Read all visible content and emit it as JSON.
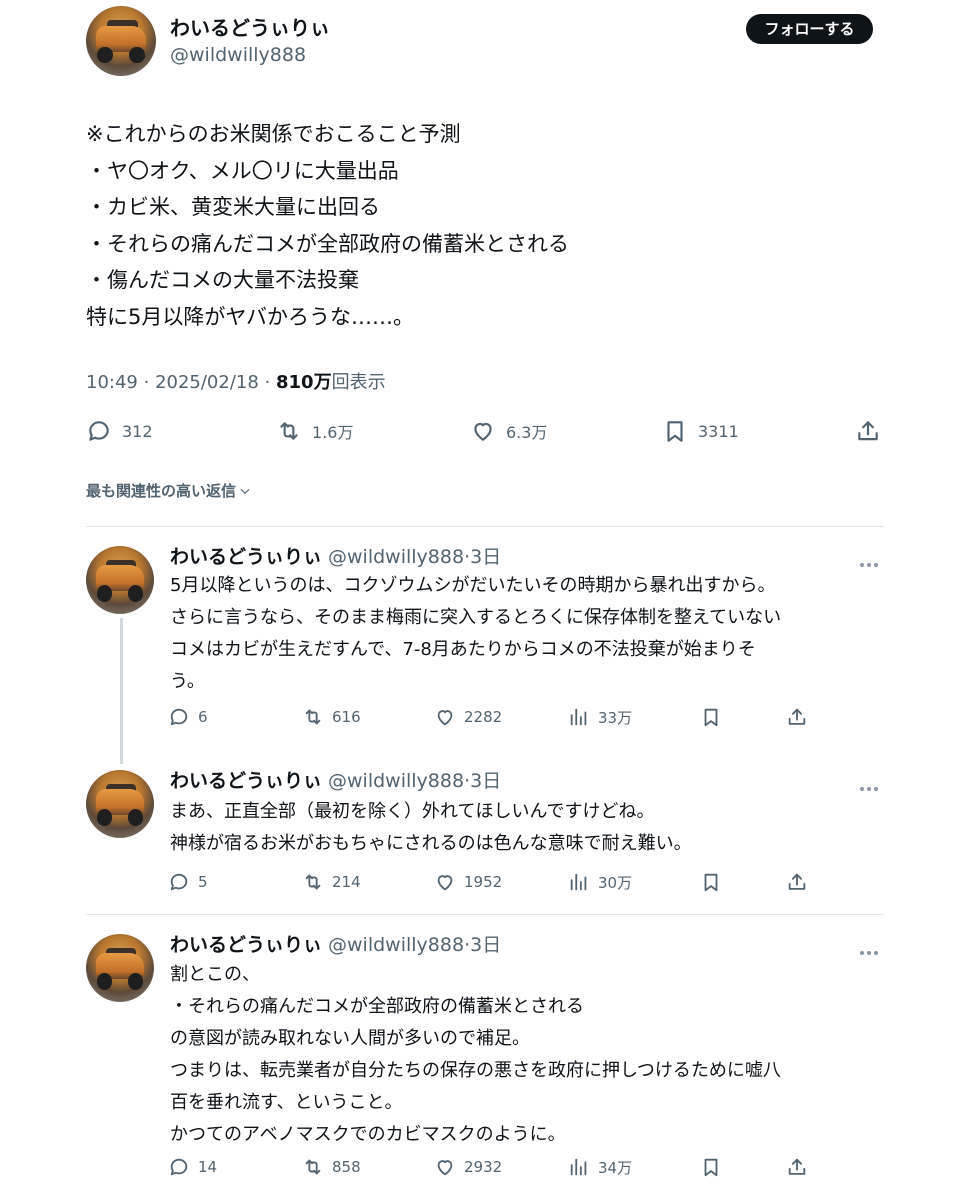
{
  "main_tweet": {
    "author_name": "わいるどうぃりぃ",
    "author_handle": "@wildwilly888",
    "follow_label": "フォローする",
    "lines": [
      "※これからのお米関係でおこること予測",
      "・ヤ〇オク、メル〇リに大量出品",
      "・カビ米、黄変米大量に出回る",
      "・それらの痛んだコメが全部政府の備蓄米とされる",
      "・傷んだコメの大量不法投棄",
      "特に5月以降がヤバかろうな……。"
    ],
    "time": "10:49",
    "date": "2025/02/18",
    "views_count": "810万",
    "views_label": "回表示",
    "stats": {
      "replies": "312",
      "retweets": "1.6万",
      "likes": "6.3万",
      "bookmarks": "3311"
    }
  },
  "sort_label": "最も関連性の高い返信",
  "replies": [
    {
      "author_name": "わいるどうぃりぃ",
      "author_handle": "@wildwilly888",
      "age": "3日",
      "lines": [
        "5月以降というのは、コクゾウムシがだいたいその時期から暴れ出すから。",
        "さらに言うなら、そのまま梅雨に突入するとろくに保存体制を整えていない",
        "コメはカビが生えだすんで、7-8月あたりからコメの不法投棄が始まりそ",
        "う。"
      ],
      "stats": {
        "replies": "6",
        "retweets": "616",
        "likes": "2282",
        "views": "33万"
      }
    },
    {
      "author_name": "わいるどうぃりぃ",
      "author_handle": "@wildwilly888",
      "age": "3日",
      "lines": [
        "まあ、正直全部（最初を除く）外れてほしいんですけどね。",
        "神様が宿るお米がおもちゃにされるのは色んな意味で耐え難い。"
      ],
      "stats": {
        "replies": "5",
        "retweets": "214",
        "likes": "1952",
        "views": "30万"
      }
    },
    {
      "author_name": "わいるどうぃりぃ",
      "author_handle": "@wildwilly888",
      "age": "3日",
      "lines": [
        "割とこの、",
        "・それらの痛んだコメが全部政府の備蓄米とされる",
        "の意図が読み取れない人間が多いので補足。",
        "つまりは、転売業者が自分たちの保存の悪さを政府に押しつけるために嘘八",
        "百を垂れ流す、ということ。",
        "かつてのアベノマスクでのカビマスクのように。"
      ],
      "stats": {
        "replies": "14",
        "retweets": "858",
        "likes": "2932",
        "views": "34万"
      }
    }
  ]
}
